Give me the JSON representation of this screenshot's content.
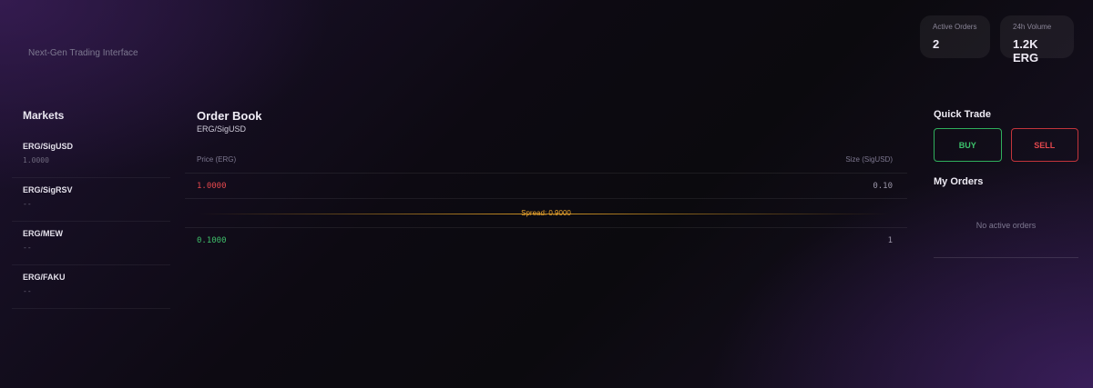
{
  "header": {
    "tagline": "Next-Gen Trading Interface",
    "stats": [
      {
        "label": "Active Orders",
        "value": "2"
      },
      {
        "label": "24h Volume",
        "value": "1.2K ERG"
      }
    ]
  },
  "markets": {
    "title": "Markets",
    "items": [
      {
        "pair": "ERG/SigUSD",
        "price": "1.0000"
      },
      {
        "pair": "ERG/SigRSV",
        "price": "--"
      },
      {
        "pair": "ERG/MEW",
        "price": "--"
      },
      {
        "pair": "ERG/FAKU",
        "price": "--"
      }
    ]
  },
  "orderbook": {
    "title": "Order Book",
    "pair": "ERG/SigUSD",
    "columns": {
      "price": "Price (ERG)",
      "size": "Size (SigUSD)"
    },
    "asks": [
      {
        "price": "1.0000",
        "size": "0.10"
      }
    ],
    "spread": "Spread: 0.9000",
    "bids": [
      {
        "price": "0.1000",
        "size": "1"
      }
    ]
  },
  "quick_trade": {
    "title": "Quick Trade",
    "buy_label": "BUY",
    "sell_label": "SELL"
  },
  "my_orders": {
    "title": "My Orders",
    "empty_text": "No active orders"
  },
  "colors": {
    "buy": "#3cc46c",
    "sell": "#e5484d",
    "spread": "#f0a830"
  }
}
